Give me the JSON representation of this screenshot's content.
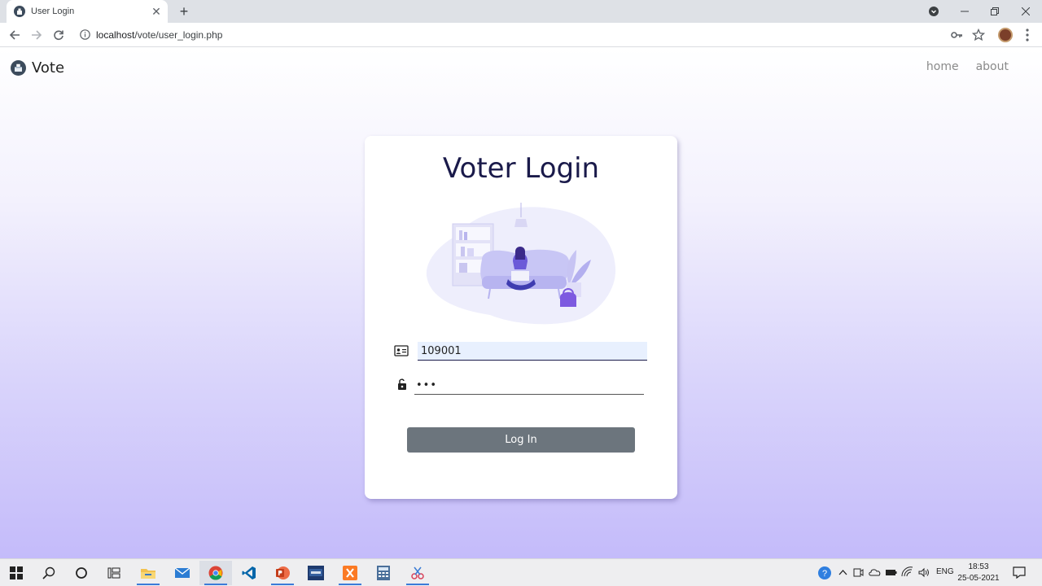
{
  "browser": {
    "tab_title": "User Login",
    "tab_close": "✕",
    "new_tab": "+",
    "url_host": "localhost",
    "url_path": "/vote/user_login.php"
  },
  "page": {
    "brand": "Vote",
    "nav": [
      "home",
      "about"
    ],
    "card_title": "Voter Login",
    "voter_id_value": "109001",
    "password_value": "•••",
    "login_label": "Log In"
  },
  "taskbar": {
    "language": "ENG",
    "time": "18:53",
    "date": "25-05-2021"
  },
  "colors": {
    "button": "#6c757d",
    "title": "#1a1a4a",
    "accent_purple": "#8b7cf5"
  }
}
